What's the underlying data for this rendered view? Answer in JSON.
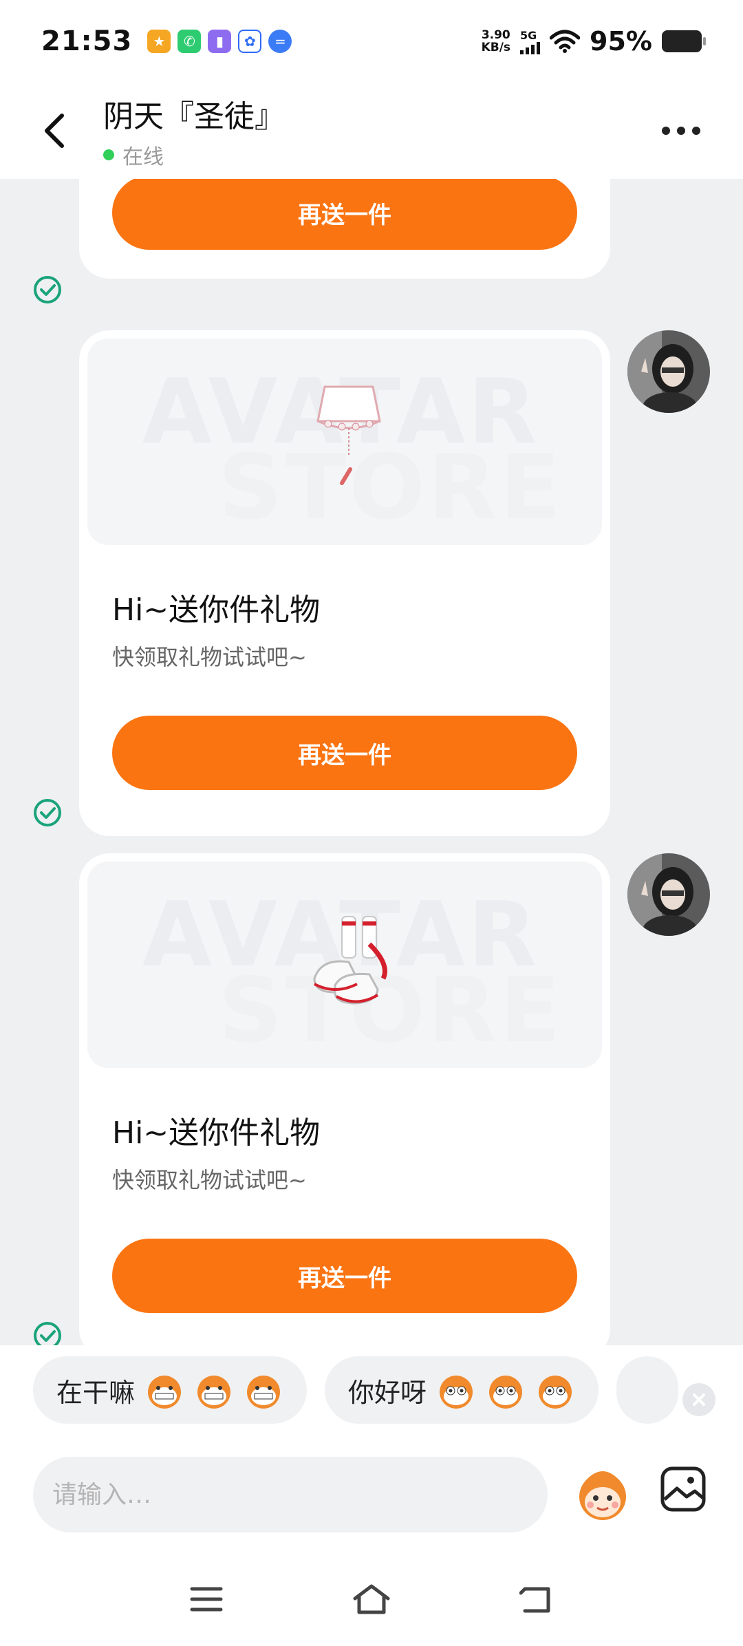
{
  "status_bar": {
    "time": "21:53",
    "net_speed_value": "3.90",
    "net_speed_unit": "KB/s",
    "network": "5G",
    "battery": "95%"
  },
  "header": {
    "contact_name": "阴天『圣徒』",
    "status": "在线"
  },
  "messages": {
    "top_card": {
      "button_label": "再送一件"
    },
    "gift_card_1": {
      "watermark_line1": "AVATAR",
      "watermark_line2": "STORE",
      "title": "Hi~送你件礼物",
      "subtitle": "快领取礼物试试吧~",
      "button_label": "再送一件",
      "gift_icon": "skirt-gift-icon"
    },
    "gift_card_2": {
      "watermark_line1": "AVATAR",
      "watermark_line2": "STORE",
      "title": "Hi~送你件礼物",
      "subtitle": "快领取礼物试试吧~",
      "button_label": "再送一件",
      "gift_icon": "shoes-gift-icon"
    }
  },
  "quick_replies": [
    {
      "text": "在干嘛"
    },
    {
      "text": "你好呀"
    }
  ],
  "composer": {
    "placeholder": "请输入…"
  },
  "colors": {
    "accent_orange": "#fb7412",
    "online_green": "#2fcf5a",
    "check_green": "#1aa37a"
  }
}
